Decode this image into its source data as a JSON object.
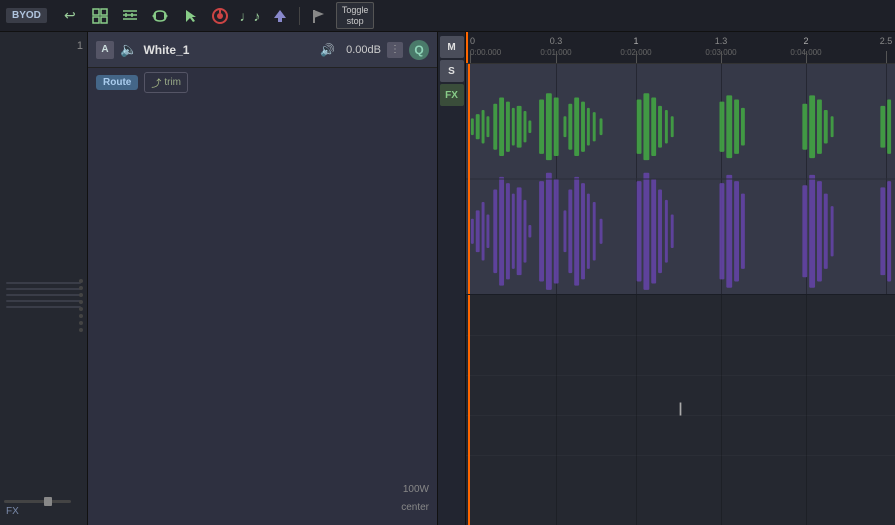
{
  "topbar": {
    "byod_label": "BYOD",
    "toggle_stop": "Toggle\nstop",
    "buttons": [
      {
        "name": "undo",
        "icon": "↩",
        "label": "undo-btn"
      },
      {
        "name": "grid",
        "icon": "⊞",
        "label": "grid-btn"
      },
      {
        "name": "lines",
        "icon": "≡",
        "label": "lines-btn"
      },
      {
        "name": "loop",
        "icon": "↺",
        "label": "loop-btn"
      },
      {
        "name": "cursor",
        "icon": "↑",
        "label": "cursor-btn"
      },
      {
        "name": "knob",
        "icon": "◉",
        "label": "knob-btn"
      },
      {
        "name": "music",
        "icon": "♩",
        "label": "music-btn"
      },
      {
        "name": "arrow-up",
        "icon": "⇑",
        "label": "arrowup-btn"
      },
      {
        "name": "flag",
        "icon": "⚑",
        "label": "flag-btn"
      }
    ]
  },
  "track": {
    "icon_a": "A",
    "name": "White_1",
    "db_value": "0.00dB",
    "route_label": "Route",
    "trim_label": "trim",
    "vol": "100W",
    "pan": "center",
    "track_number": "1",
    "mfx_m": "M",
    "mfx_s": "S",
    "mfx_fx": "FX"
  },
  "timeline": {
    "markers": [
      {
        "beat": "0",
        "time": "0:00.000",
        "pos": 0
      },
      {
        "beat": "0.3",
        "time": "0:01.000",
        "pos": 90
      },
      {
        "beat": "1",
        "time": "0:02.000",
        "pos": 170
      },
      {
        "beat": "1.3",
        "time": "0:03.000",
        "pos": 255
      },
      {
        "beat": "2",
        "time": "0:04.000",
        "pos": 340
      },
      {
        "beat": "2.5",
        "time": "",
        "pos": 420
      }
    ]
  },
  "sidebar": {
    "fx_label": "FX"
  },
  "empty_area": {
    "cursor_label": "I"
  }
}
